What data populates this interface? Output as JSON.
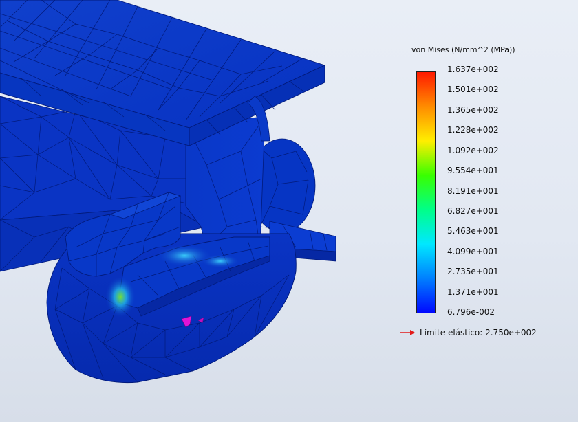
{
  "legend": {
    "title": "von Mises (N/mm^2 (MPa))",
    "ticks": [
      "1.637e+002",
      "1.501e+002",
      "1.365e+002",
      "1.228e+002",
      "1.092e+002",
      "9.554e+001",
      "8.191e+001",
      "6.827e+001",
      "5.463e+001",
      "4.099e+001",
      "2.735e+001",
      "1.371e+001",
      "6.796e-002"
    ],
    "colormap": [
      "#ff1a00",
      "#ff8c00",
      "#ffee00",
      "#39ff00",
      "#00ff88",
      "#00e8ff",
      "#0080ff",
      "#0008ff"
    ]
  },
  "yield": {
    "text": "Límite elástico: 2.750e+002",
    "arrow_color": "#e21a1a"
  },
  "colors": {
    "mesh_blue": "#0a2fc4",
    "mesh_dark": "#031b8c",
    "stress_cyan": "#22b8e8",
    "stress_green": "#7ce82a",
    "hotspot_magenta": "#e014d6"
  }
}
